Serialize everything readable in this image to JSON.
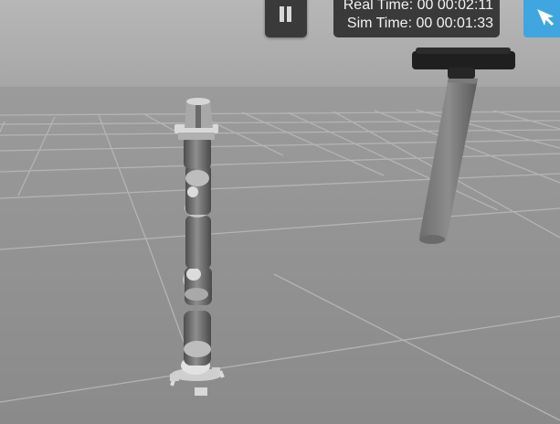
{
  "toolbar": {
    "pause_icon": "pause-icon",
    "select_icon": "arrow-cursor-icon",
    "accent_color": "#3fa6e0"
  },
  "time": {
    "real_label": "Real Time:",
    "real_value": "00 00:02:11",
    "sim_label": "Sim Time:",
    "sim_value": "00 00:01:33"
  }
}
